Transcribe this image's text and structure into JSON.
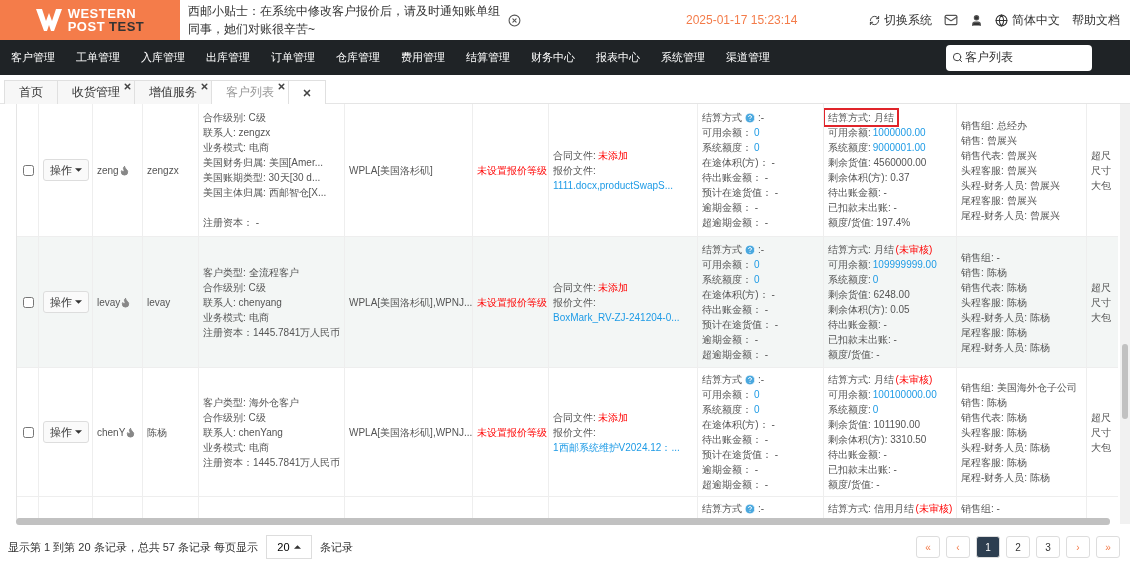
{
  "header": {
    "logo": {
      "line1": "WESTERN",
      "line2a": "POST",
      "line2b": "TEST"
    },
    "notice": "西邮小贴士：在系统中修改客户报价后，请及时通知账单组同事，她们对账很辛苦~",
    "datetime": "2025-01-17 15:23:14",
    "switch_system": "切换系统",
    "language": "简体中文",
    "help": "帮助文档"
  },
  "nav": {
    "items": [
      "客户管理",
      "工单管理",
      "入库管理",
      "出库管理",
      "订单管理",
      "仓库管理",
      "费用管理",
      "结算管理",
      "财务中心",
      "报表中心",
      "系统管理",
      "渠道管理"
    ],
    "search": {
      "value": "客户列表"
    }
  },
  "tabs": [
    {
      "label": "首页",
      "closable": false,
      "selected": false
    },
    {
      "label": "收货管理",
      "closable": true,
      "selected": false
    },
    {
      "label": "增值服务",
      "closable": true,
      "selected": false
    },
    {
      "label": "客户列表",
      "closable": true,
      "selected": true
    }
  ],
  "table": {
    "rows": [
      {
        "partial": false,
        "selected": false,
        "highlighted": false,
        "action": "操作",
        "code": "zeng",
        "hot": true,
        "name": "zengzx",
        "info": [
          {
            "label": "合作级别: C级"
          },
          {
            "label": "联系人: zengzx"
          },
          {
            "label": "业务模式: 电商"
          },
          {
            "label": "美国财务归属: 美国[Amer..."
          },
          {
            "label": "美国账期类型: 30天[30 d..."
          },
          {
            "label": "美国主体归属: 西邮智仓[X..."
          },
          {
            "label": "注册资本： -",
            "spaced": true
          }
        ],
        "warehouse": "WPLA[美国洛杉矶]",
        "quote_level": "未设置报价等级",
        "files": [
          {
            "label": "合同文件:",
            "value": "未添加",
            "kind": "alert"
          },
          {
            "label": "报价文件:"
          },
          {
            "value": "1111.docx,productSwapS...",
            "kind": "link"
          }
        ],
        "settlement": [
          {
            "label": "结算方式",
            "help": true,
            "value": ":-"
          },
          {
            "label": "可用余额：",
            "value": "0",
            "kind": "link"
          },
          {
            "label": "系统额度：",
            "value": "0",
            "kind": "link"
          },
          {
            "label": "在途体积(方)： -"
          },
          {
            "label": "待出账金额： -"
          },
          {
            "label": "预计在途货值： -"
          },
          {
            "label": "逾期金额： -"
          },
          {
            "label": "超逾期金额： -"
          }
        ],
        "credit": [
          {
            "label": "结算方式: 月结",
            "boxed": true
          },
          {
            "label": "可用余额:",
            "value": "1000000.00",
            "kind": "link"
          },
          {
            "label": "系统额度:",
            "value": "9000001.00",
            "kind": "link"
          },
          {
            "label": "剩余货值: 4560000.00"
          },
          {
            "label": "剩余体积(方): 0.37"
          },
          {
            "label": "待出账金额: -"
          },
          {
            "label": "已扣款未出账: -"
          },
          {
            "label": "额度/货值: 197.4%"
          }
        ],
        "staff": [
          {
            "label": "销售组: 总经办"
          },
          {
            "label": "销售: 曾展兴"
          },
          {
            "label": "销售代表: 曾展兴"
          },
          {
            "label": "头程客服: 曾展兴"
          },
          {
            "label": "头程-财务人员: 曾展兴"
          },
          {
            "label": "尾程客服: 曾展兴"
          },
          {
            "label": "尾程-财务人员: 曾展兴"
          }
        ],
        "extra": [
          {
            "label": "超尺"
          },
          {
            "label": "尺寸"
          },
          {
            "label": "大包"
          }
        ]
      },
      {
        "partial": false,
        "selected": false,
        "highlighted": true,
        "action": "操作",
        "code": "levay",
        "hot": true,
        "name": "levay",
        "info": [
          {
            "label": "客户类型: 全流程客户"
          },
          {
            "label": "合作级别: C级"
          },
          {
            "label": "联系人: chenyang"
          },
          {
            "label": "业务模式: 电商"
          },
          {
            "label": "注册资本：1445.7841万人民币"
          }
        ],
        "warehouse": "WPLA[美国洛杉矶],WPNJ...",
        "quote_level": "未设置报价等级",
        "files": [
          {
            "label": "合同文件:",
            "value": "未添加",
            "kind": "alert"
          },
          {
            "label": "报价文件:"
          },
          {
            "value": "BoxMark_RV-ZJ-241204-0...",
            "kind": "link"
          }
        ],
        "settlement": [
          {
            "label": "结算方式",
            "help": true,
            "value": ":-"
          },
          {
            "label": "可用余额：",
            "value": "0",
            "kind": "link"
          },
          {
            "label": "系统额度：",
            "value": "0",
            "kind": "link"
          },
          {
            "label": "在途体积(方)： -"
          },
          {
            "label": "待出账金额： -"
          },
          {
            "label": "预计在途货值： -"
          },
          {
            "label": "逾期金额： -"
          },
          {
            "label": "超逾期金额： -"
          }
        ],
        "credit": [
          {
            "label": "结算方式: 月结",
            "note": "(未审核)"
          },
          {
            "label": "可用余额:",
            "value": "109999999.00",
            "kind": "link"
          },
          {
            "label": "系统额度:",
            "value": "0",
            "kind": "link"
          },
          {
            "label": "剩余货值: 6248.00"
          },
          {
            "label": "剩余体积(方): 0.05"
          },
          {
            "label": "待出账金额: -"
          },
          {
            "label": "已扣款未出账: -"
          },
          {
            "label": "额度/货值: -"
          }
        ],
        "staff": [
          {
            "label": "销售组: -"
          },
          {
            "label": "销售: 陈杨"
          },
          {
            "label": "销售代表: 陈杨"
          },
          {
            "label": "头程客服: 陈杨"
          },
          {
            "label": "头程-财务人员: 陈杨"
          },
          {
            "label": "尾程客服: 陈杨"
          },
          {
            "label": "尾程-财务人员: 陈杨"
          }
        ],
        "extra": [
          {
            "label": "超尺"
          },
          {
            "label": "尺寸"
          },
          {
            "label": "大包"
          }
        ]
      },
      {
        "partial": false,
        "selected": false,
        "highlighted": false,
        "action": "操作",
        "code": "chenY",
        "hot": true,
        "name": "陈杨",
        "info": [
          {
            "label": "客户类型: 海外仓客户"
          },
          {
            "label": "合作级别: C级"
          },
          {
            "label": "联系人: chenYang"
          },
          {
            "label": "业务模式: 电商"
          },
          {
            "label": "注册资本：1445.7841万人民币"
          }
        ],
        "warehouse": "WPLA[美国洛杉矶],WPNJ...",
        "quote_level": "未设置报价等级",
        "files": [
          {
            "label": "合同文件:",
            "value": "未添加",
            "kind": "alert"
          },
          {
            "label": "报价文件:"
          },
          {
            "value": "1西邮系统维护V2024.12：...",
            "kind": "link"
          }
        ],
        "settlement": [
          {
            "label": "结算方式",
            "help": true,
            "value": ":-"
          },
          {
            "label": "可用余额：",
            "value": "0",
            "kind": "link"
          },
          {
            "label": "系统额度：",
            "value": "0",
            "kind": "link"
          },
          {
            "label": "在途体积(方)： -"
          },
          {
            "label": "待出账金额： -"
          },
          {
            "label": "预计在途货值： -"
          },
          {
            "label": "逾期金额： -"
          },
          {
            "label": "超逾期金额： -"
          }
        ],
        "credit": [
          {
            "label": "结算方式: 月结",
            "note": "(未审核)"
          },
          {
            "label": "可用余额:",
            "value": "100100000.00",
            "kind": "link"
          },
          {
            "label": "系统额度:",
            "value": "0",
            "kind": "link"
          },
          {
            "label": "剩余货值: 101190.00"
          },
          {
            "label": "剩余体积(方): 3310.50"
          },
          {
            "label": "待出账金额: -"
          },
          {
            "label": "已扣款未出账: -"
          },
          {
            "label": "额度/货值: -"
          }
        ],
        "staff": [
          {
            "label": "销售组: 美国海外仓子公司"
          },
          {
            "label": "销售: 陈杨"
          },
          {
            "label": "销售代表: 陈杨"
          },
          {
            "label": "头程客服: 陈杨"
          },
          {
            "label": "头程-财务人员: 陈杨"
          },
          {
            "label": "尾程客服: 陈杨"
          },
          {
            "label": "尾程-财务人员: 陈杨"
          }
        ],
        "extra": [
          {
            "label": "超尺"
          },
          {
            "label": "尺寸"
          },
          {
            "label": "大包"
          }
        ]
      },
      {
        "partial": true,
        "highlighted": false,
        "settlement": [
          {
            "label": "结算方式",
            "help": true,
            "value": ":-"
          }
        ],
        "credit": [
          {
            "label": "结算方式: 信用月结",
            "note": "(未审核)"
          }
        ],
        "staff": [
          {
            "label": "销售组: -"
          }
        ]
      }
    ]
  },
  "pagination": {
    "summary": "显示第 1 到第 20 条记录，总共 57 条记录 每页显示",
    "page_size": "20",
    "suffix": "条记录",
    "pages": [
      {
        "label": "«",
        "kind": "edge",
        "selected": false
      },
      {
        "label": "‹",
        "kind": "edge",
        "selected": false
      },
      {
        "label": "1",
        "kind": "page",
        "selected": true
      },
      {
        "label": "2",
        "kind": "page",
        "selected": false
      },
      {
        "label": "3",
        "kind": "page",
        "selected": false
      },
      {
        "label": "›",
        "kind": "edge",
        "selected": false
      },
      {
        "label": "»",
        "kind": "edge",
        "selected": false
      }
    ]
  }
}
